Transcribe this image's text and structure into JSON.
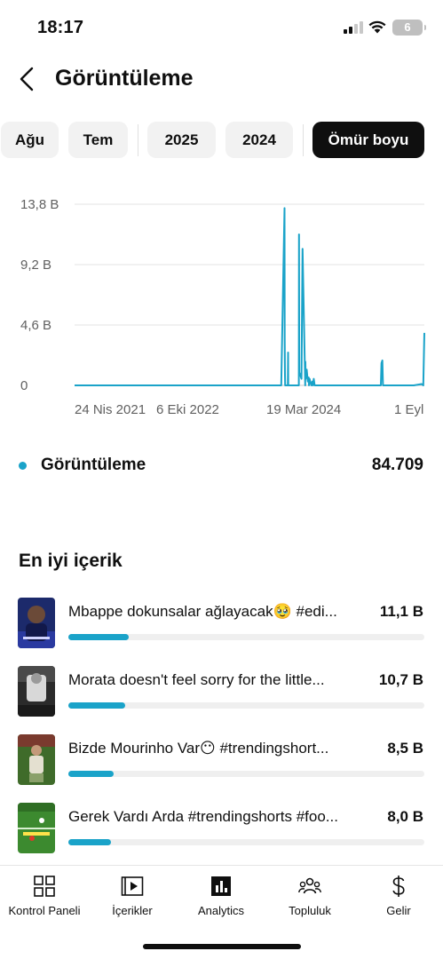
{
  "status_bar": {
    "time": "18:17",
    "battery": "6"
  },
  "header": {
    "title": "Görüntüleme"
  },
  "chips": [
    {
      "label": "Ağu",
      "active": false
    },
    {
      "label": "Tem",
      "active": false
    },
    {
      "label": "2025",
      "active": false
    },
    {
      "label": "2024",
      "active": false
    },
    {
      "label": "Ömür boyu",
      "active": true
    }
  ],
  "chart_data": {
    "type": "line",
    "title": "",
    "xlabel": "",
    "ylabel": "",
    "y_ticks": [
      "13,8 B",
      "9,2 B",
      "4,6 B",
      "0"
    ],
    "y_tick_values": [
      13800,
      9200,
      4600,
      0
    ],
    "x_ticks": [
      "24 Nis 2021",
      "6 Eki 2022",
      "19 Mar 2024",
      "1 Eyl"
    ],
    "ylim": [
      0,
      13800
    ],
    "series_color": "#1aa3c9",
    "grid": true,
    "series": [
      {
        "x": [
          "2021-04-24",
          "2023-11-20",
          "2023-12-05",
          "2023-12-06",
          "2023-12-07",
          "2023-12-08",
          "2023-12-20",
          "2023-12-21",
          "2023-12-22",
          "2024-01-10",
          "2024-02-08",
          "2024-02-09",
          "2024-02-10",
          "2024-02-20",
          "2024-02-25",
          "2024-03-08",
          "2024-03-09",
          "2024-03-10",
          "2024-03-15",
          "2024-03-20",
          "2024-03-24",
          "2024-03-25",
          "2024-03-28",
          "2024-04-05",
          "2024-04-10",
          "2024-04-12",
          "2024-04-16",
          "2024-04-20",
          "2025-02-15",
          "2025-02-18",
          "2025-02-22",
          "2025-02-25",
          "2025-03-05",
          "2025-07-15",
          "2025-08-20",
          "2025-08-27",
          "2025-09-01"
        ],
        "y": [
          0,
          0,
          13500,
          3500,
          800,
          0,
          0,
          2500,
          0,
          0,
          0,
          11500,
          1000,
          500,
          10400,
          0,
          1800,
          500,
          1200,
          300,
          600,
          0,
          500,
          0,
          300,
          0,
          500,
          0,
          0,
          1700,
          1900,
          0,
          0,
          0,
          100,
          0,
          4000
        ]
      }
    ]
  },
  "metric": {
    "label": "Görüntüleme",
    "value": "84.709"
  },
  "top_content": {
    "title": "En iyi içerik",
    "items": [
      {
        "title": "Mbappe dokunsalar ağlayacak🥹 #edi...",
        "value": "11,1 B",
        "share": 0.17
      },
      {
        "title": "Morata doesn't feel sorry for the little...",
        "value": "10,7 B",
        "share": 0.16
      },
      {
        "title": "Bizde Mourinho Var😶 #trendingshort...",
        "value": "8,5 B",
        "share": 0.127
      },
      {
        "title": "Gerek Vardı Arda #trendingshorts #foo...",
        "value": "8,0 B",
        "share": 0.12
      }
    ]
  },
  "bottom_nav": [
    {
      "label": "Kontrol Paneli",
      "icon": "dashboard-icon"
    },
    {
      "label": "İçerikler",
      "icon": "content-icon"
    },
    {
      "label": "Analytics",
      "icon": "analytics-icon"
    },
    {
      "label": "Topluluk",
      "icon": "community-icon"
    },
    {
      "label": "Gelir",
      "icon": "earn-icon"
    }
  ]
}
